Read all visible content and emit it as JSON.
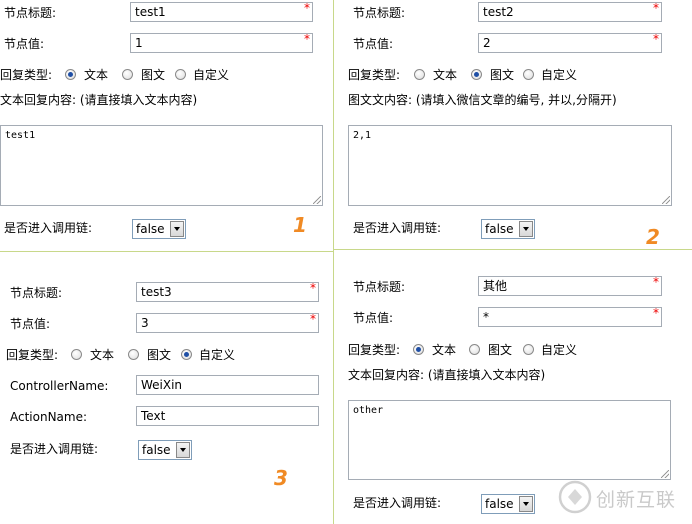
{
  "labels": {
    "title": "节点标题:",
    "value": "节点值:",
    "reply_type": "回复类型:",
    "text_reply": "文本回复内容: (请直接填入文本内容)",
    "image_reply": "图文文内容: (请填入微信文章的编号, 并以,分隔开)",
    "chain": "是否进入调用链:",
    "controller": "ControllerName:",
    "action": "ActionName:",
    "opt_text": "文本",
    "opt_image": "图文",
    "opt_custom": "自定义",
    "required": "*"
  },
  "panels": [
    {
      "number": "1",
      "title": "test1",
      "value": "1",
      "reply_type": "文本",
      "content": "test1",
      "chain": "false"
    },
    {
      "number": "2",
      "title": "test2",
      "value": "2",
      "reply_type": "图文",
      "content": "2,1",
      "chain": "false"
    },
    {
      "number": "3",
      "title": "test3",
      "value": "3",
      "reply_type": "自定义",
      "controller": "WeiXin",
      "action": "Text",
      "chain": "false"
    },
    {
      "title": "其他",
      "value": "*",
      "reply_type": "文本",
      "content": "other",
      "chain": "false"
    }
  ],
  "watermark": {
    "text": "创新互联"
  }
}
